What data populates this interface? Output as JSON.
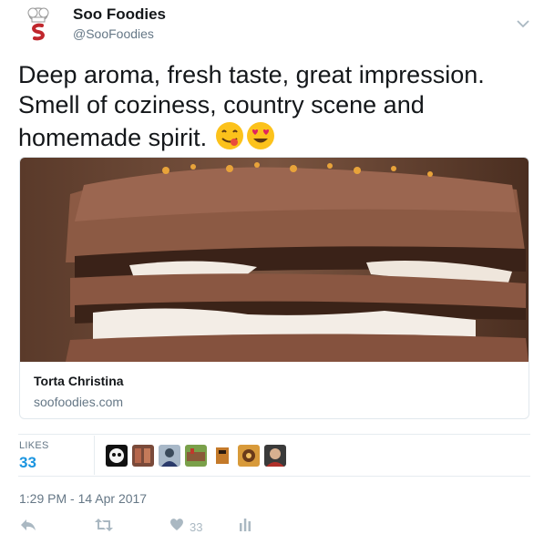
{
  "author": {
    "name": "Soo Foodies",
    "handle": "@SooFoodies"
  },
  "tweet": {
    "text": "Deep aroma, fresh taste, great impression.\nSmell of coziness, country scene and\nhomemade spirit. ",
    "emojis": [
      "face-savoring-food-emoji",
      "heart-eyes-emoji"
    ]
  },
  "card": {
    "title": "Torta Christina",
    "domain": "soofoodies.com"
  },
  "stats": {
    "likes_label": "LIKES",
    "likes_count": "33",
    "liker_avatars": 7
  },
  "timestamp": "1:29 PM - 14 Apr 2017",
  "actions": {
    "like_count": "33"
  },
  "colors": {
    "link_blue": "#1b95e0",
    "muted": "#657786",
    "action_gray": "#aab8c2"
  }
}
